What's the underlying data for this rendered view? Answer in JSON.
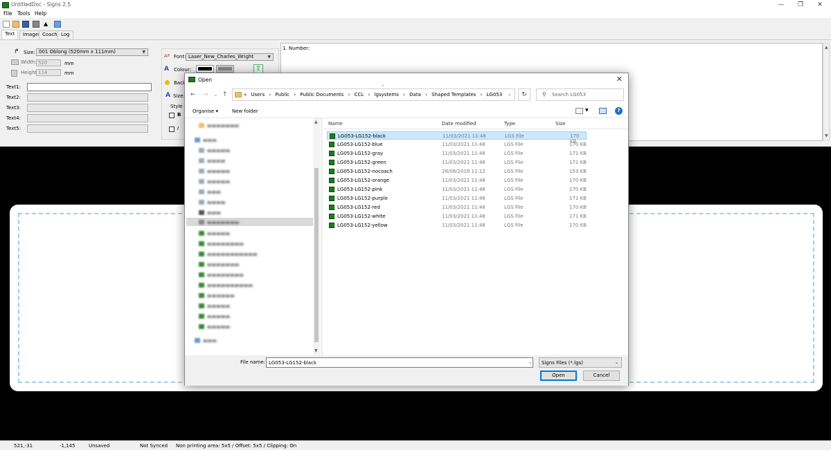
{
  "window": {
    "title": "UntitledDoc - Signs 2.5"
  },
  "menu": [
    "File",
    "Tools",
    "Help"
  ],
  "tabs": [
    "Text",
    "Images",
    "Coach",
    "Log"
  ],
  "panel": {
    "size_label": "Size:",
    "size_value": "001 Oblong (520mm x 111mm)",
    "width_label": "Width:",
    "width_value": "520",
    "height_label": "Height:",
    "height_value": "114",
    "unit": "mm",
    "text_labels": [
      "Text1:",
      "Text2:",
      "Text3:",
      "Text4:",
      "Text5:"
    ],
    "font_label": "Font:",
    "font_value": "Laser_New_Charles_Wright",
    "colour_label": "Colour:",
    "back_label": "Back",
    "size2_label": "Size:",
    "style_label": "Style",
    "bold": "B",
    "italic": "I",
    "number_label": "1. Number:"
  },
  "status": {
    "coords": "521,-31",
    "offset": "-1,145",
    "saved": "Unsaved",
    "sync": "Not Synced",
    "info": "Non printing area: 5x5 / Offset: 5x5 / Clipping: On"
  },
  "dialog": {
    "title": "Open",
    "breadcrumbs": [
      "«",
      "Users",
      "›",
      "Public",
      "›",
      "Public Documents",
      "›",
      "CCL",
      "›",
      "lgsystems",
      "›",
      "Data",
      "›",
      "Shaped Templates",
      "›",
      "LG053"
    ],
    "search_placeholder": "Search LG053",
    "organise": "Organise ▾",
    "new_folder": "New folder",
    "columns": [
      "Name",
      "Date modified",
      "Type",
      "Size"
    ],
    "files": [
      {
        "name": "LG053-LG152-black",
        "date": "11/03/2021 11:48",
        "type": "LGS File",
        "size": "170 KB"
      },
      {
        "name": "LG053-LG152-blue",
        "date": "11/03/2021 11:48",
        "type": "LGS File",
        "size": "170 KB"
      },
      {
        "name": "LG053-LG152-gray",
        "date": "11/03/2021 11:48",
        "type": "LGS File",
        "size": "171 KB"
      },
      {
        "name": "LG053-LG152-green",
        "date": "11/03/2021 11:48",
        "type": "LGS File",
        "size": "171 KB"
      },
      {
        "name": "LG053-LG152-nocoach",
        "date": "28/08/2019 11:12",
        "type": "LGS File",
        "size": "153 KB"
      },
      {
        "name": "LG053-LG152-orange",
        "date": "11/03/2021 11:48",
        "type": "LGS File",
        "size": "170 KB"
      },
      {
        "name": "LG053-LG152-pink",
        "date": "11/03/2021 11:48",
        "type": "LGS File",
        "size": "170 KB"
      },
      {
        "name": "LG053-LG152-purple",
        "date": "11/03/2021 11:48",
        "type": "LGS File",
        "size": "171 KB"
      },
      {
        "name": "LG053-LG152-red",
        "date": "11/03/2021 11:48",
        "type": "LGS File",
        "size": "170 KB"
      },
      {
        "name": "LG053-LG152-white",
        "date": "11/03/2021 11:48",
        "type": "LGS File",
        "size": "171 KB"
      },
      {
        "name": "LG053-LG152-yellow",
        "date": "11/03/2021 11:48",
        "type": "LGS File",
        "size": "170 KB"
      }
    ],
    "filename_label": "File name:",
    "filename_value": "LG053-LG152-black",
    "filetype": "Signs Files (*.lgs)",
    "open_button": "Open",
    "cancel_button": "Cancel"
  },
  "colors": {
    "selection": "#cce8ff",
    "canvas": "#000000",
    "sign_border": "#9ed0e6",
    "brand_green": "#1f7a1f"
  }
}
